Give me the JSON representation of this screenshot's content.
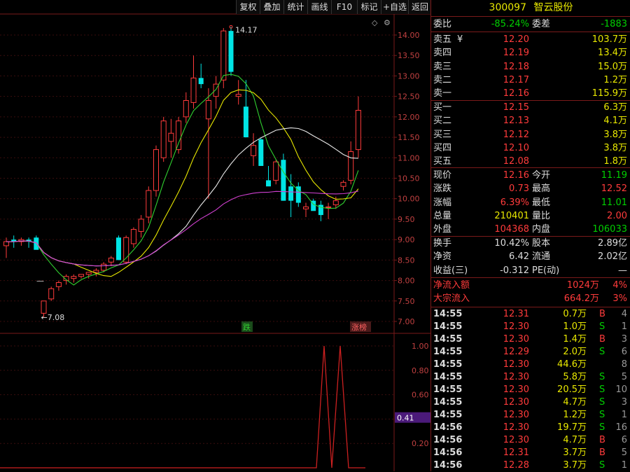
{
  "toolbar": [
    "复权",
    "叠加",
    "统计",
    "画线",
    "F10",
    "标记",
    "+自选",
    "返回"
  ],
  "stock": {
    "code": "300097",
    "name": "智云股份"
  },
  "price_axis": [
    "14.00",
    "13.50",
    "13.00",
    "12.50",
    "12.00",
    "11.50",
    "11.00",
    "10.50",
    "10.00",
    "9.50",
    "9.00",
    "8.50",
    "8.00",
    "7.50",
    "7.00"
  ],
  "ind_axis": [
    "1.00",
    "0.80",
    "0.60",
    "0.40",
    "0.20"
  ],
  "ind_value_label": "0.41",
  "chart_labels": {
    "high": "14.17",
    "low": "7.08",
    "tag_die": "跌",
    "tag_zhangbang": "涨榜",
    "dash": "—"
  },
  "weibi": {
    "label": "委比",
    "value": "-85.24%",
    "label2": "委差",
    "value2": "-1883"
  },
  "asks": [
    {
      "label": "卖五",
      "price": "12.20",
      "vol": "103.7万"
    },
    {
      "label": "卖四",
      "price": "12.19",
      "vol": "13.4万"
    },
    {
      "label": "卖三",
      "price": "12.18",
      "vol": "15.0万"
    },
    {
      "label": "卖二",
      "price": "12.17",
      "vol": "1.2万"
    },
    {
      "label": "卖一",
      "price": "12.16",
      "vol": "115.9万"
    }
  ],
  "ask_currency": "¥",
  "bids": [
    {
      "label": "买一",
      "price": "12.15",
      "vol": "6.3万"
    },
    {
      "label": "买二",
      "price": "12.13",
      "vol": "4.1万"
    },
    {
      "label": "买三",
      "price": "12.12",
      "vol": "3.8万"
    },
    {
      "label": "买四",
      "price": "12.10",
      "vol": "3.8万"
    },
    {
      "label": "买五",
      "price": "12.08",
      "vol": "1.8万"
    }
  ],
  "stats": [
    {
      "l1": "现价",
      "v1": "12.16",
      "c1": "red",
      "l2": "今开",
      "v2": "11.19",
      "c2": "green"
    },
    {
      "l1": "涨跌",
      "v1": "0.73",
      "c1": "red",
      "l2": "最高",
      "v2": "12.52",
      "c2": "red"
    },
    {
      "l1": "涨幅",
      "v1": "6.39%",
      "c1": "red",
      "l2": "最低",
      "v2": "11.01",
      "c2": "green"
    },
    {
      "l1": "总量",
      "v1": "210401",
      "c1": "yellow",
      "l2": "量比",
      "v2": "2.00",
      "c2": "red"
    },
    {
      "l1": "外盘",
      "v1": "104368",
      "c1": "red",
      "l2": "内盘",
      "v2": "106033",
      "c2": "green"
    }
  ],
  "fin": [
    {
      "l1": "换手",
      "v1": "10.42%",
      "l2": "股本",
      "v2": "2.89亿"
    },
    {
      "l1": "净资",
      "v1": "6.42",
      "l2": "流通",
      "v2": "2.02亿"
    },
    {
      "l1": "收益(三)",
      "v1": "-0.312",
      "l2": "PE(动)",
      "v2": "—"
    }
  ],
  "flow": [
    {
      "label": "净流入额",
      "value": "1024万",
      "pct": "4%"
    },
    {
      "label": "大宗流入",
      "value": "664.2万",
      "pct": "3%"
    }
  ],
  "ticks": [
    {
      "t": "14:55",
      "p": "12.31",
      "v": "0.7万",
      "d": "B",
      "n": "4"
    },
    {
      "t": "14:55",
      "p": "12.30",
      "v": "1.0万",
      "d": "S",
      "n": "1"
    },
    {
      "t": "14:55",
      "p": "12.30",
      "v": "1.4万",
      "d": "B",
      "n": "3"
    },
    {
      "t": "14:55",
      "p": "12.29",
      "v": "2.0万",
      "d": "S",
      "n": "6"
    },
    {
      "t": "14:55",
      "p": "12.30",
      "v": "44.6万",
      "d": "",
      "n": "8"
    },
    {
      "t": "14:55",
      "p": "12.30",
      "v": "5.8万",
      "d": "S",
      "n": "5"
    },
    {
      "t": "14:55",
      "p": "12.30",
      "v": "20.5万",
      "d": "S",
      "n": "10"
    },
    {
      "t": "14:55",
      "p": "12.30",
      "v": "4.7万",
      "d": "S",
      "n": "3"
    },
    {
      "t": "14:55",
      "p": "12.30",
      "v": "1.2万",
      "d": "S",
      "n": "1"
    },
    {
      "t": "14:56",
      "p": "12.30",
      "v": "19.7万",
      "d": "S",
      "n": "16"
    },
    {
      "t": "14:56",
      "p": "12.30",
      "v": "4.7万",
      "d": "B",
      "n": "6"
    },
    {
      "t": "14:56",
      "p": "12.31",
      "v": "3.7万",
      "d": "B",
      "n": "5"
    },
    {
      "t": "14:56",
      "p": "12.28",
      "v": "3.7万",
      "d": "S",
      "n": "1"
    }
  ],
  "chart_data": {
    "type": "candlestick",
    "ylim": [
      7.0,
      14.2
    ],
    "ohlc": [
      [
        8.85,
        9.05,
        8.55,
        8.95
      ],
      [
        9.0,
        9.1,
        8.8,
        8.95
      ],
      [
        8.95,
        9.05,
        8.85,
        9.0
      ],
      [
        9.0,
        9.05,
        8.8,
        8.95
      ],
      [
        9.05,
        9.1,
        8.8,
        8.75
      ],
      [
        7.2,
        7.4,
        7.1,
        7.5
      ],
      [
        7.55,
        7.85,
        7.5,
        7.8
      ],
      [
        7.85,
        8.0,
        7.75,
        7.95
      ],
      [
        8.0,
        8.15,
        7.9,
        8.1
      ],
      [
        8.05,
        8.15,
        7.95,
        8.1
      ],
      [
        8.1,
        8.15,
        8.05,
        8.15
      ],
      [
        8.15,
        8.2,
        8.05,
        8.2
      ],
      [
        8.2,
        8.3,
        8.1,
        8.25
      ],
      [
        8.25,
        8.45,
        8.2,
        8.4
      ],
      [
        8.45,
        8.6,
        8.35,
        8.55
      ],
      [
        9.05,
        9.1,
        8.5,
        8.5
      ],
      [
        8.45,
        9.1,
        8.4,
        9.05
      ],
      [
        8.9,
        9.3,
        8.8,
        9.25
      ],
      [
        9.2,
        9.6,
        9.05,
        9.5
      ],
      [
        9.55,
        10.3,
        9.4,
        10.2
      ],
      [
        10.2,
        11.3,
        10.05,
        11.2
      ],
      [
        11.0,
        12.0,
        10.9,
        11.9
      ],
      [
        11.4,
        11.95,
        11.0,
        11.6
      ],
      [
        11.2,
        12.0,
        11.1,
        11.9
      ],
      [
        12.0,
        12.6,
        11.85,
        12.4
      ],
      [
        12.35,
        13.5,
        12.2,
        12.95
      ],
      [
        12.95,
        13.3,
        12.7,
        12.8
      ],
      [
        11.95,
        12.7,
        10.0,
        12.4
      ],
      [
        12.5,
        13.0,
        12.2,
        12.8
      ],
      [
        12.9,
        14.17,
        12.7,
        14.1
      ],
      [
        14.1,
        14.2,
        13.0,
        13.1
      ],
      [
        12.5,
        12.9,
        12.3,
        12.55
      ],
      [
        12.25,
        12.9,
        11.5,
        11.5
      ],
      [
        11.05,
        11.6,
        10.8,
        11.3
      ],
      [
        11.45,
        11.5,
        10.8,
        10.8
      ],
      [
        10.45,
        10.8,
        10.4,
        10.3
      ],
      [
        10.45,
        10.95,
        10.35,
        10.9
      ],
      [
        10.95,
        11.1,
        9.95,
        9.95
      ],
      [
        10.3,
        10.6,
        9.55,
        9.95
      ],
      [
        10.3,
        10.4,
        9.8,
        9.9
      ],
      [
        9.75,
        9.9,
        9.55,
        9.8
      ],
      [
        9.95,
        10.0,
        9.85,
        9.7
      ],
      [
        9.85,
        9.95,
        9.45,
        9.6
      ],
      [
        9.8,
        9.9,
        9.5,
        9.8
      ],
      [
        9.85,
        10.05,
        9.75,
        9.95
      ],
      [
        10.3,
        10.45,
        10.2,
        10.4
      ],
      [
        10.45,
        11.4,
        10.35,
        11.15
      ],
      [
        11.2,
        12.5,
        11.0,
        12.16
      ]
    ],
    "indicator_peaks": [
      1.0,
      1.0
    ]
  }
}
